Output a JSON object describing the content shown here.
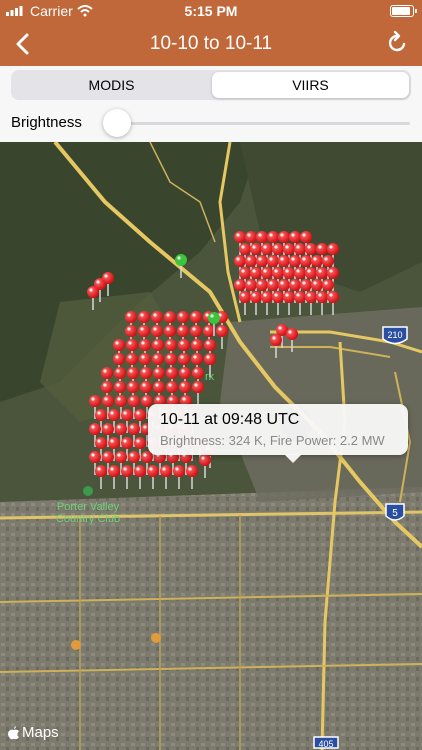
{
  "status_bar": {
    "carrier": "Carrier",
    "time": "5:15 PM"
  },
  "nav": {
    "title": "10-10 to 10-11",
    "back_icon": "chevron-left-icon",
    "refresh_icon": "refresh-icon"
  },
  "segments": {
    "options": [
      "MODIS",
      "VIIRS"
    ],
    "selected": "VIIRS"
  },
  "brightness": {
    "label": "Brightness",
    "slider_value": 0
  },
  "callout": {
    "title": "10-11 at 09:48 UTC",
    "subtitle": "Brightness: 324 K, Fire Power: 2.2 MW"
  },
  "map_labels": {
    "park": "Porter Valley\nCountry Club",
    "park_fragment": "rk",
    "hwy_210": "210",
    "hwy_5": "5",
    "hwy_405": "405"
  },
  "maps_attribution": "Maps",
  "colors": {
    "header": "#c0683a",
    "pin": "#e8141a",
    "pin_green": "#3cc43c"
  }
}
